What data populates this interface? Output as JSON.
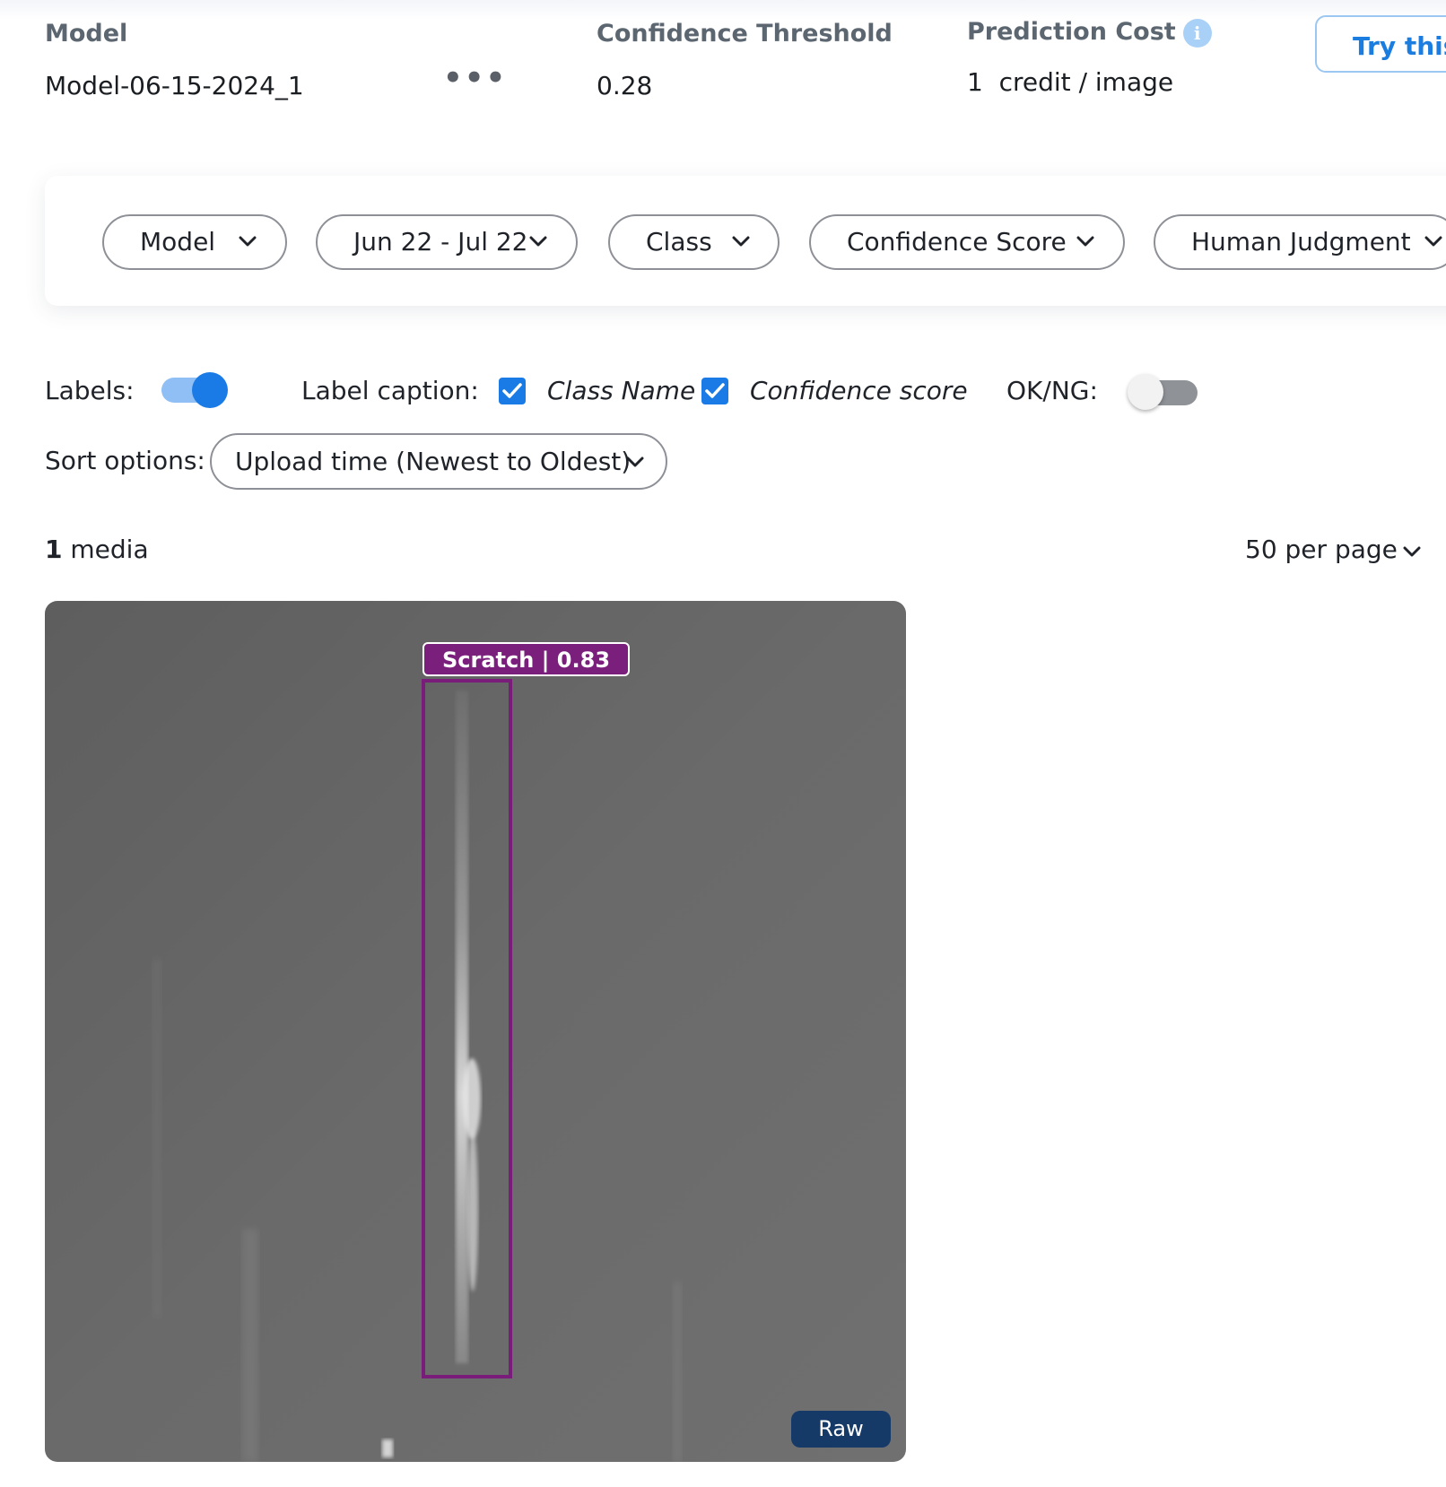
{
  "header": {
    "model_label": "Model",
    "model_value": "Model-06-15-2024_1",
    "more_icon": "more-horizontal-icon",
    "threshold_label": "Confidence Threshold",
    "threshold_value": "0.28",
    "cost_label": "Prediction Cost",
    "cost_value": "1  credit / image",
    "info_icon": "info-icon",
    "try_button": "Try this"
  },
  "filters": [
    {
      "label": "Model"
    },
    {
      "label": "Jun 22 - Jul 22"
    },
    {
      "label": "Class"
    },
    {
      "label": "Confidence Score"
    },
    {
      "label": "Human Judgment"
    }
  ],
  "display": {
    "labels_label": "Labels:",
    "labels_on": true,
    "caption_label": "Label caption:",
    "class_name": "Class Name",
    "class_name_checked": true,
    "confidence_score": "Confidence score",
    "confidence_checked": true,
    "okng_label": "OK/NG:",
    "okng_on": false
  },
  "sort": {
    "label": "Sort options:",
    "value": "Upload time (Newest to Oldest)"
  },
  "results": {
    "count": "1",
    "count_suffix": "media",
    "per_page": "50 per page"
  },
  "image": {
    "prediction_label": "Scratch | 0.83",
    "view_badge": "Raw",
    "box_color": "#7a1c7a"
  }
}
